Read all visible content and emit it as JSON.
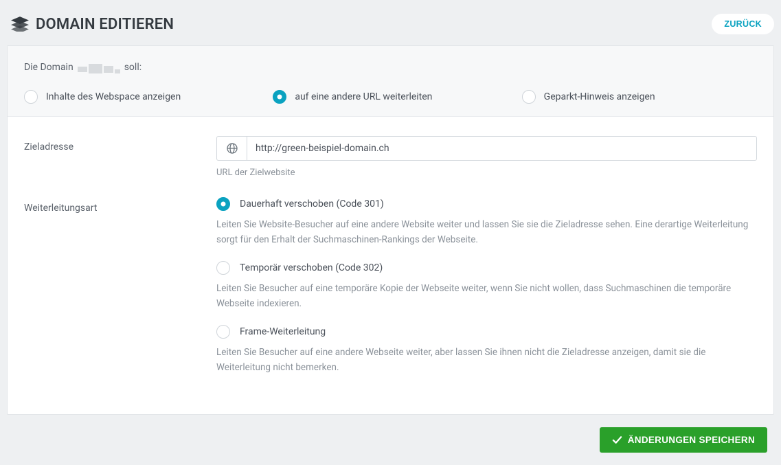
{
  "header": {
    "title": "DOMAIN EDITIEREN",
    "back_label": "ZURÜCK"
  },
  "top": {
    "prefix": "Die Domain",
    "suffix": "soll:",
    "option_webspace": "Inhalte des Webspace anzeigen",
    "option_redirect": "auf eine andere URL weiterleiten",
    "option_parked": "Geparkt-Hinweis anzeigen"
  },
  "form": {
    "target_label": "Zieladresse",
    "target_value": "http://green-beispiel-domain.ch",
    "target_help": "URL der Zielwebsite",
    "redirect_type_label": "Weiterleitungsart",
    "options": {
      "r301": {
        "title": "Dauerhaft verschoben (Code 301)",
        "desc": "Leiten Sie Website-Besucher auf eine andere Website weiter und lassen Sie sie die Zieladresse sehen. Eine derartige Weiterleitung sorgt für den Erhalt der Suchmaschinen-Rankings der Webseite."
      },
      "r302": {
        "title": "Temporär verschoben (Code 302)",
        "desc": "Leiten Sie Besucher auf eine temporäre Kopie der Webseite weiter, wenn Sie nicht wollen, dass Suchmaschinen die temporäre Webseite indexieren."
      },
      "frame": {
        "title": "Frame-Weiterleitung",
        "desc": "Leiten Sie Besucher auf eine andere Webseite weiter, aber lassen Sie ihnen nicht die Zieladresse anzeigen, damit sie die Weiterleitung nicht bemerken."
      }
    }
  },
  "footer": {
    "save_label": "ÄNDERUNGEN SPEICHERN"
  }
}
